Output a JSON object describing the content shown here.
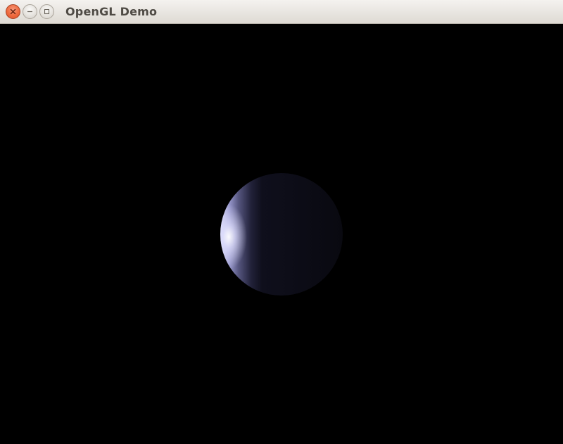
{
  "window": {
    "title": "OpenGL Demo",
    "controls": {
      "close_icon": "close-icon",
      "minimize_icon": "minimize-icon",
      "maximize_icon": "maximize-icon"
    }
  },
  "viewport": {
    "background_color": "#000000",
    "object": "sphere",
    "object_base_color": "#0b0b14",
    "highlight_color": "#e8e8ff"
  }
}
